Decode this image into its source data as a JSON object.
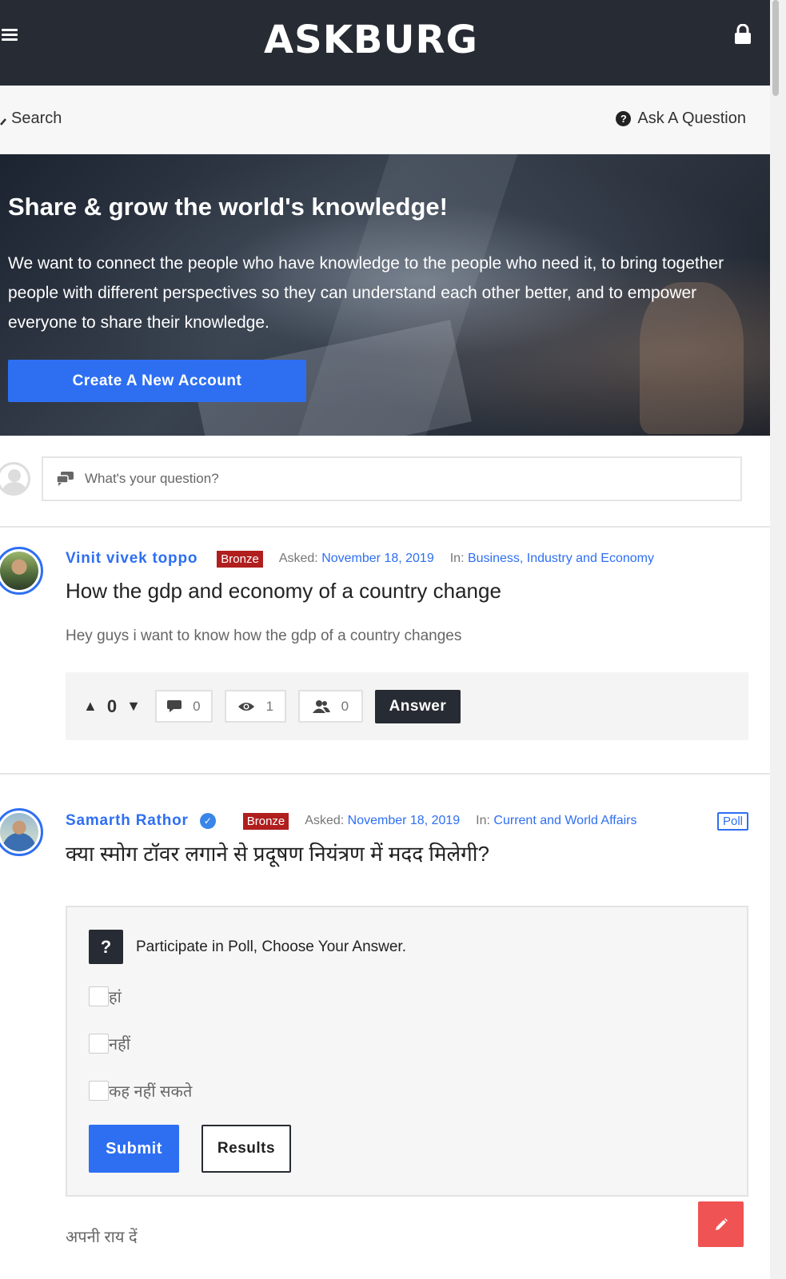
{
  "header": {
    "logo": "ASKBURG",
    "search_label": "Search",
    "ask_label": "Ask A Question"
  },
  "hero": {
    "title": "Share & grow the world's knowledge!",
    "description": "We want to connect the people who have knowledge to the people who need it, to bring together people with different perspectives so they can understand each other better, and to empower everyone to share their knowledge.",
    "cta": "Create A New Account"
  },
  "ask_box": {
    "placeholder": "What's your question?"
  },
  "questions": [
    {
      "author": "Vinit vivek toppo",
      "badge": "Bronze",
      "asked_label": "Asked:",
      "asked_date": "November 18, 2019",
      "in_label": "In:",
      "category": "Business, Industry and Economy",
      "title": "How the gdp and economy of a country change",
      "excerpt": "Hey guys i want to know how the gdp of a country changes",
      "votes": "0",
      "comments": "0",
      "views": "1",
      "followers": "0",
      "answer_label": "Answer"
    },
    {
      "author": "Samarth Rathor",
      "verified_mark": "✓",
      "badge": "Bronze",
      "asked_label": "Asked:",
      "asked_date": "November 18, 2019",
      "in_label": "In:",
      "category": "Current and World Affairs",
      "tag": "Poll",
      "title": "क्या स्मोग टॉवर लगाने से प्रदूषण नियंत्रण में मदद मिलेगी?",
      "poll": {
        "heading": "Participate in Poll, Choose Your Answer.",
        "icon_glyph": "?",
        "options": [
          "हां",
          "नहीं",
          "कह नहीं सकते"
        ],
        "submit_label": "Submit",
        "results_label": "Results"
      },
      "footer_text": "अपनी राय दें"
    }
  ],
  "colors": {
    "accent": "#2e6ff2",
    "dark": "#272b33",
    "badge": "#b01e1e",
    "fab": "#ef5353"
  },
  "icons": {
    "menu": "menu-icon",
    "lock": "lock-icon",
    "search": "search-icon",
    "ask": "question-circle-icon",
    "comment": "comment-icon",
    "views": "eye-icon",
    "followers": "users-icon",
    "edit": "pencil-icon"
  }
}
